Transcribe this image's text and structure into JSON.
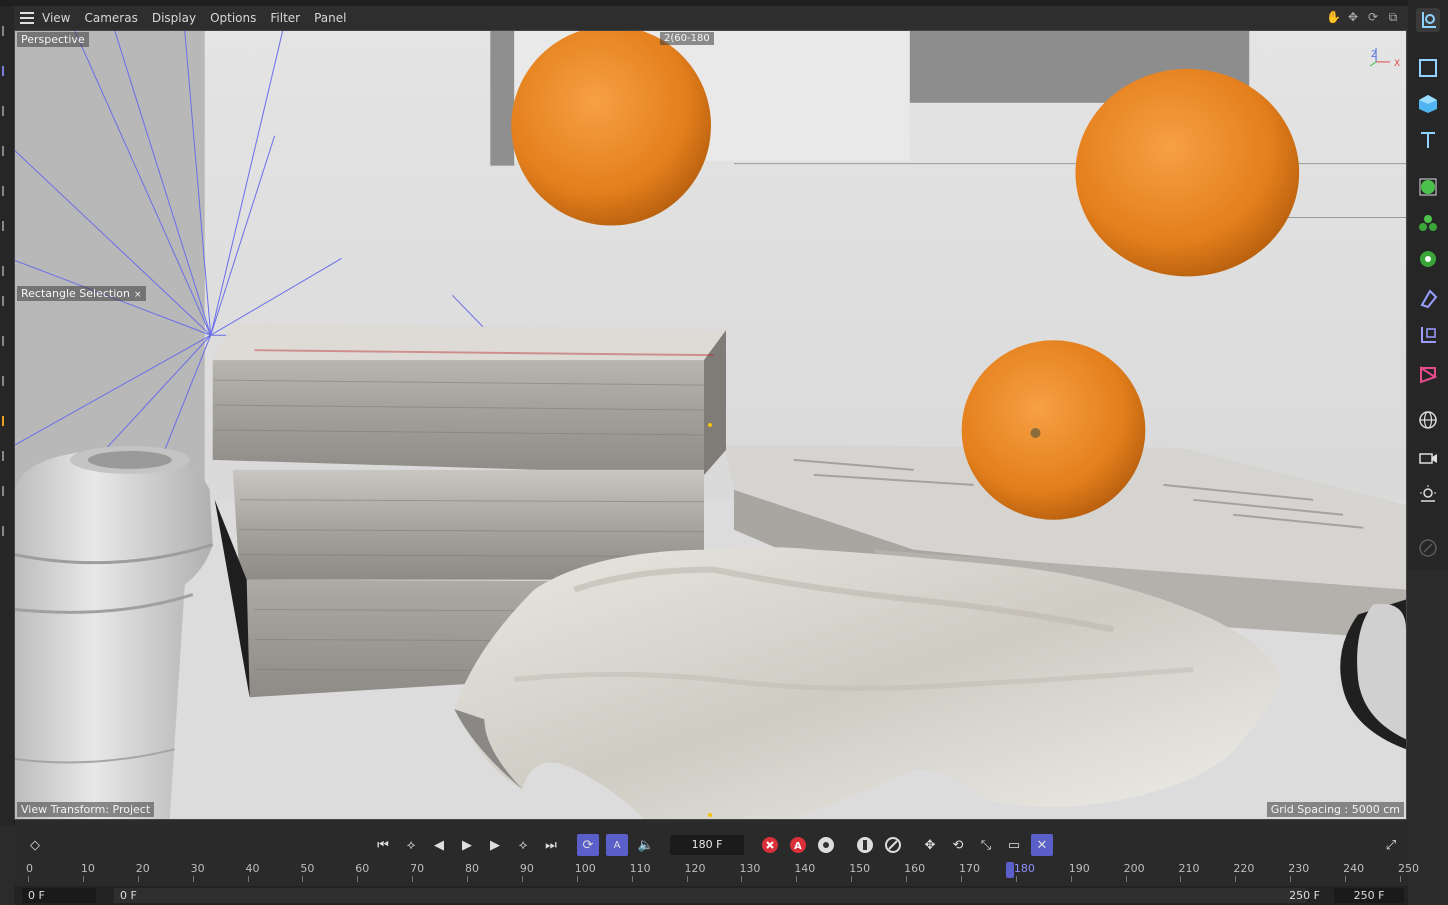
{
  "menubar": {
    "items": [
      "View",
      "Cameras",
      "Display",
      "Options",
      "Filter",
      "Panel"
    ]
  },
  "viewport": {
    "camera_label": "Perspective",
    "resolution_label": "2(60-180",
    "tool_label": "Rectangle Selection",
    "view_transform": "View Transform: Project",
    "grid_spacing": "Grid Spacing : 5000 cm",
    "axis_z": "Z",
    "axis_x": "X"
  },
  "timeline": {
    "current_frame": "180 F",
    "ruler_ticks": [
      "0",
      "10",
      "20",
      "30",
      "40",
      "50",
      "60",
      "70",
      "80",
      "90",
      "100",
      "110",
      "120",
      "130",
      "140",
      "150",
      "160",
      "170",
      "180",
      "190",
      "200",
      "210",
      "220",
      "230",
      "240",
      "250"
    ],
    "playhead_frame": 180,
    "start_field": "0 F",
    "start_field2": "0 F",
    "end_field": "250 F",
    "end_field2": "250 F"
  },
  "colors": {
    "accent": "#5a5fc9",
    "orange": "#e8841e",
    "record": "#d9303a"
  }
}
